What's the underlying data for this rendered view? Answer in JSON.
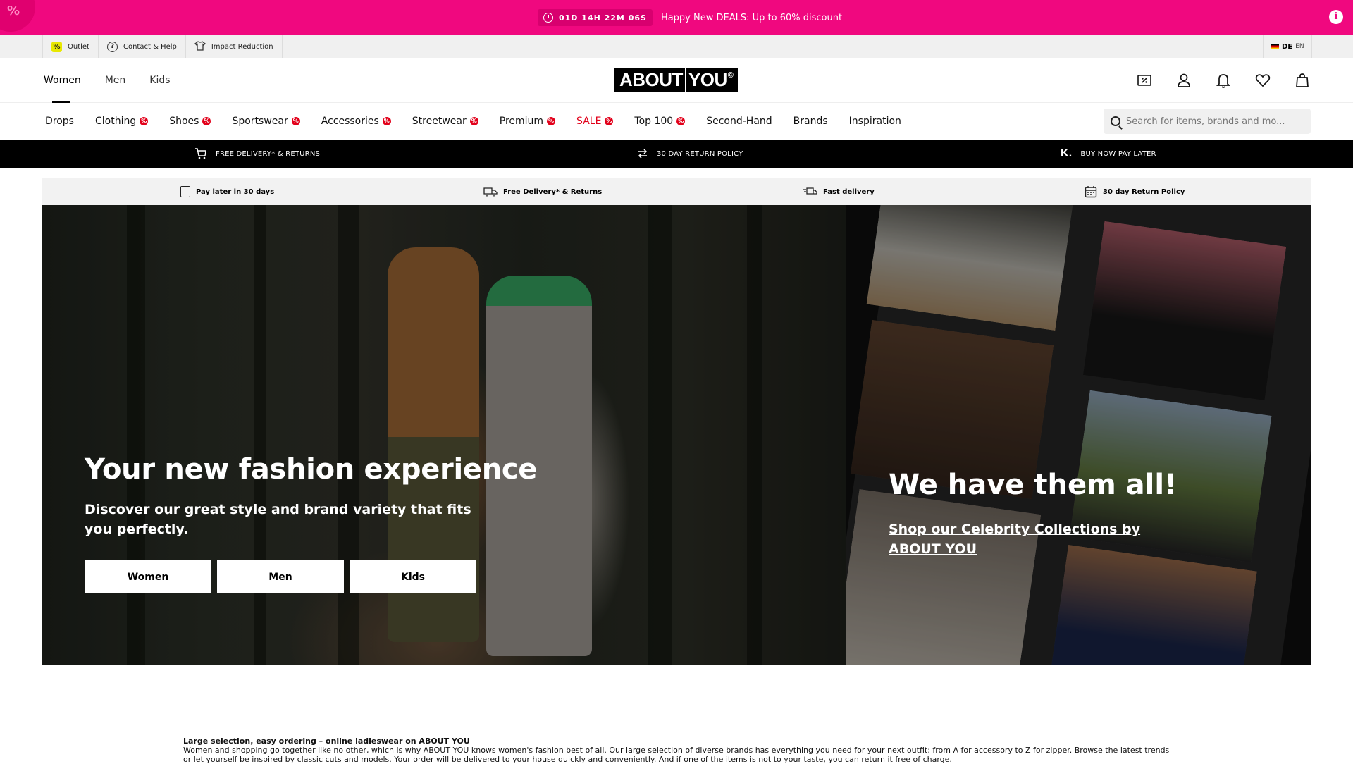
{
  "promo": {
    "timer": "01D 14H 22M 06S",
    "text": "Happy New DEALS: Up to 60% discount",
    "corner_symbol": "%",
    "info_symbol": "i"
  },
  "service_bar": {
    "links": [
      {
        "label": "Outlet",
        "icon": "percent-tag-icon"
      },
      {
        "label": "Contact & Help",
        "icon": "question-circle-icon"
      },
      {
        "label": "Impact Reduction",
        "icon": "tshirt-icon"
      }
    ],
    "language": {
      "active": "DE",
      "other": "EN"
    }
  },
  "header": {
    "gender_tabs": [
      "Women",
      "Men",
      "Kids"
    ],
    "active_tab": "Women",
    "logo": {
      "left": "ABOUT",
      "right": "YOU",
      "mark": "©"
    },
    "icons": [
      "discount-icon",
      "account-icon",
      "notification-bell-icon",
      "wishlist-heart-icon",
      "shopping-bag-icon"
    ]
  },
  "categories": [
    {
      "label": "Drops",
      "badge": false
    },
    {
      "label": "Clothing",
      "badge": true
    },
    {
      "label": "Shoes",
      "badge": true
    },
    {
      "label": "Sportswear",
      "badge": true
    },
    {
      "label": "Accessories",
      "badge": true
    },
    {
      "label": "Streetwear",
      "badge": true
    },
    {
      "label": "Premium",
      "badge": true
    },
    {
      "label": "SALE",
      "badge": true
    },
    {
      "label": "Top 100",
      "badge": true
    },
    {
      "label": "Second-Hand",
      "badge": false
    },
    {
      "label": "Brands",
      "badge": false
    },
    {
      "label": "Inspiration",
      "badge": false
    }
  ],
  "badge_symbol": "%",
  "search": {
    "placeholder": "Search for items, brands and mo..."
  },
  "usp_bar": [
    {
      "label": "FREE DELIVERY* & RETURNS",
      "icon": "cart-icon"
    },
    {
      "label": "30 DAY RETURN POLICY",
      "icon": "exchange-arrows-icon"
    },
    {
      "label": "BUY NOW PAY LATER",
      "icon": "klarna-icon",
      "icon_text": "K."
    }
  ],
  "usp_strip": [
    {
      "label": "Pay later in 30 days",
      "icon": "invoice-icon"
    },
    {
      "label": "Free Delivery* & Returns",
      "icon": "delivery-truck-icon"
    },
    {
      "label": "Fast delivery",
      "icon": "fast-truck-icon"
    },
    {
      "label": "30 day Return Policy",
      "icon": "calendar-icon"
    }
  ],
  "hero_left": {
    "title": "Your new fashion experience",
    "subtitle": "Discover our great style and brand variety that fits you perfectly.",
    "buttons": [
      "Women",
      "Men",
      "Kids"
    ]
  },
  "hero_right": {
    "title": "We have them all!",
    "link": "Shop our Celebrity Collections by ABOUT YOU"
  },
  "seo": {
    "heading": "Large selection, easy ordering – online ladieswear on ABOUT YOU",
    "body": "Women and shopping go together like no other, which is why ABOUT YOU knows women's fashion best of all. Our large selection of diverse brands has everything you need for your next outfit: from A for accessory to Z for zipper. Browse the latest trends or let yourself be inspired by classic cuts and models. Your order will be delivered to your house quickly and conveniently. And if one of the items is not to your taste, you can return it free of charge."
  }
}
